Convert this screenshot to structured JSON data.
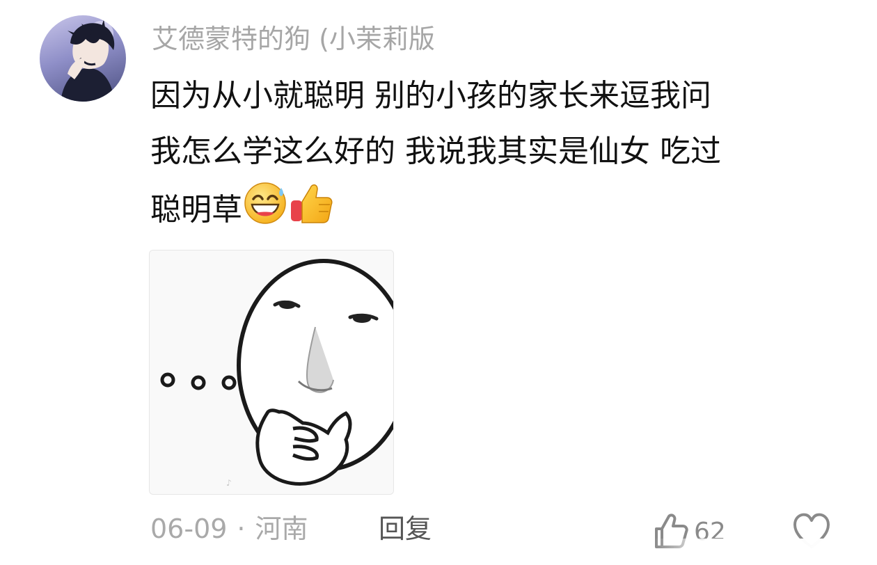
{
  "comment": {
    "username": "艾德蒙特的狗 (小茉莉版",
    "lines": [
      "因为从小就聪明 别的小孩的家长来逗我问",
      "我怎么学这么好的 我说我其实是仙女 吃过",
      "聪明草"
    ],
    "emojis": [
      "grinning-sweat-emoji",
      "thumbs-up-emoji"
    ],
    "meme_image": "thinking-face-meme",
    "date": "06-09",
    "separator": "·",
    "location": "河南",
    "reply_label": "回复",
    "like_count": "62",
    "icons": {
      "like": "thumbs-up-outline-icon",
      "more": "heart-outline-icon"
    }
  },
  "colors": {
    "username": "#a6a6a6",
    "text": "#111111",
    "meta": "#a9a9a9",
    "reply": "#555555"
  }
}
